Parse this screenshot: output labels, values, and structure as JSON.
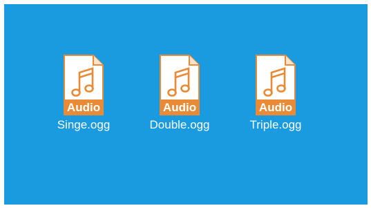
{
  "desktop": {
    "files": [
      {
        "name": "Singe.ogg",
        "type_label": "Audio",
        "icon": "audio-file-icon"
      },
      {
        "name": "Double.ogg",
        "type_label": "Audio",
        "icon": "audio-file-icon"
      },
      {
        "name": "Triple.ogg",
        "type_label": "Audio",
        "icon": "audio-file-icon"
      }
    ]
  },
  "colors": {
    "background": "#1a9be0",
    "icon_accent": "#e98a36",
    "icon_paper": "#ffffff",
    "label_text": "#ffffff"
  }
}
